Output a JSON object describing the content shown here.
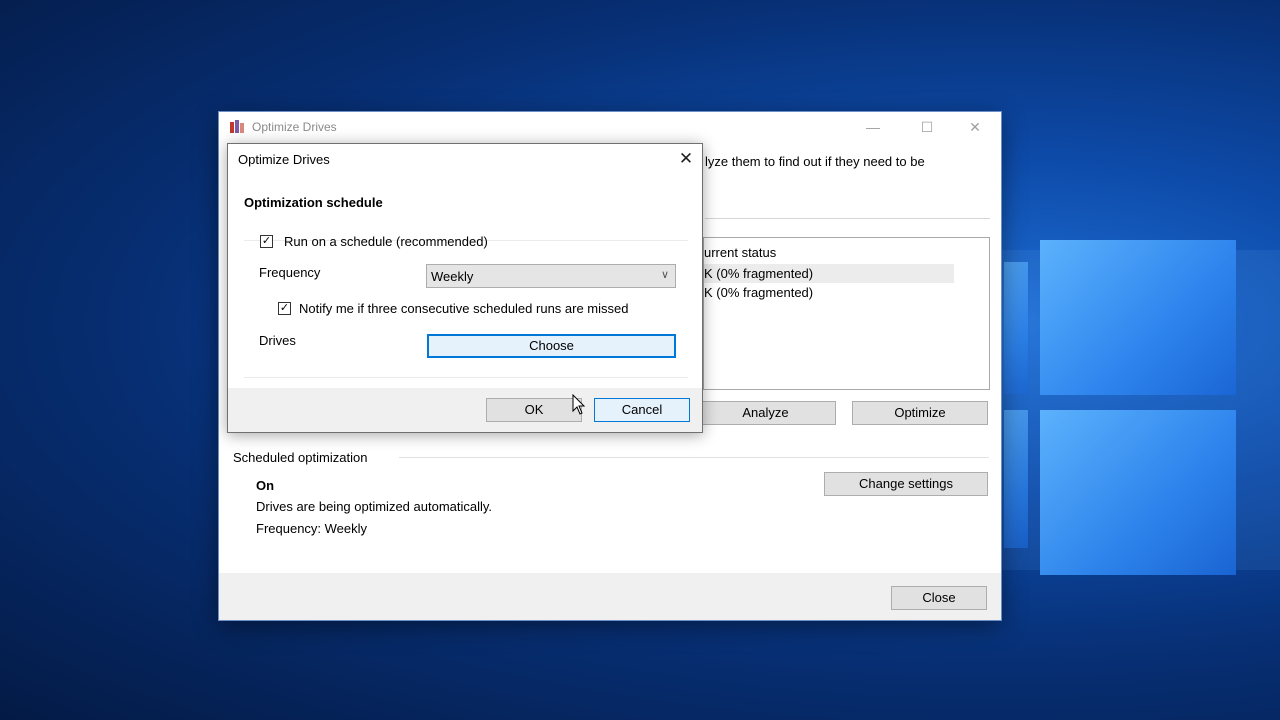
{
  "main_window": {
    "title": "Optimize Drives",
    "controls": {
      "minimize": "—",
      "maximize": "☐",
      "close": "✕"
    },
    "intro_text_partial": "lyze them to find out if they need to be",
    "list": {
      "column_status": "urrent status",
      "rows": [
        {
          "status": "K (0% fragmented)"
        },
        {
          "status": "K (0% fragmented)"
        }
      ]
    },
    "analyze_label": "Analyze",
    "optimize_label": "Optimize",
    "scheduled": {
      "section_label": "Scheduled optimization",
      "state": "On",
      "description": "Drives are being optimized automatically.",
      "frequency": "Frequency: Weekly",
      "change_settings_label": "Change settings"
    },
    "close_label": "Close"
  },
  "dialog": {
    "title": "Optimize Drives",
    "close_glyph": "✕",
    "heading": "Optimization schedule",
    "run_on_schedule": {
      "checked": true,
      "label": "Run on a schedule (recommended)"
    },
    "frequency": {
      "label": "Frequency",
      "selected": "Weekly"
    },
    "notify": {
      "checked": true,
      "label": "Notify me if three consecutive scheduled runs are missed"
    },
    "drives": {
      "label": "Drives",
      "choose_label": "Choose"
    },
    "ok_label": "OK",
    "cancel_label": "Cancel"
  },
  "icons": {
    "app_icon": "defrag-drive-icon",
    "checkmark": "✓",
    "chevron": "∨"
  },
  "colors": {
    "focus_border": "#0078d7",
    "button_face": "#e1e1e1"
  }
}
